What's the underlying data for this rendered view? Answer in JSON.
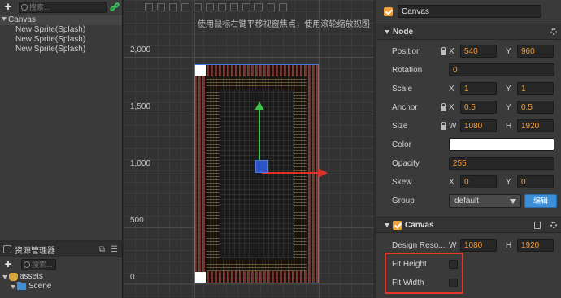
{
  "hierarchy": {
    "search_placeholder": "搜索...",
    "root": "Canvas",
    "children": [
      "New Sprite(Splash)",
      "New Sprite(Splash)",
      "New Sprite(Splash)"
    ]
  },
  "assets": {
    "tab_label": "资源管理器",
    "search_placeholder": "搜索...",
    "items": [
      "assets",
      "Scene"
    ]
  },
  "scene": {
    "hint": "使用鼠标右键平移视窗焦点，使用滚轮缩放视图",
    "y_ticks": [
      "2,000",
      "1,500",
      "1,000",
      "500",
      "0"
    ]
  },
  "inspector": {
    "node_name": "Canvas",
    "node_section": "Node",
    "position": {
      "label": "Position",
      "x": "540",
      "y": "960"
    },
    "rotation": {
      "label": "Rotation",
      "value": "0"
    },
    "scale": {
      "label": "Scale",
      "x": "1",
      "y": "1"
    },
    "anchor": {
      "label": "Anchor",
      "x": "0.5",
      "y": "0.5"
    },
    "size": {
      "label": "Size",
      "w": "1080",
      "h": "1920"
    },
    "color": {
      "label": "Color",
      "value": "#ffffff"
    },
    "opacity": {
      "label": "Opacity",
      "value": "255"
    },
    "skew": {
      "label": "Skew",
      "x": "0",
      "y": "0"
    },
    "group": {
      "label": "Group",
      "value": "default",
      "edit_button": "编辑"
    },
    "canvas_section": "Canvas",
    "design_resolution": {
      "label": "Design Reso...",
      "w": "1080",
      "h": "1920"
    },
    "fit_height": {
      "label": "Fit Height",
      "checked": false
    },
    "fit_width": {
      "label": "Fit Width",
      "checked": false
    },
    "axis_x": "X",
    "axis_y": "Y",
    "axis_w": "W",
    "axis_h": "H"
  },
  "colors": {
    "accent_orange": "#f29b3b",
    "highlight_red": "#e8362a",
    "button_blue": "#3b8ed8"
  }
}
